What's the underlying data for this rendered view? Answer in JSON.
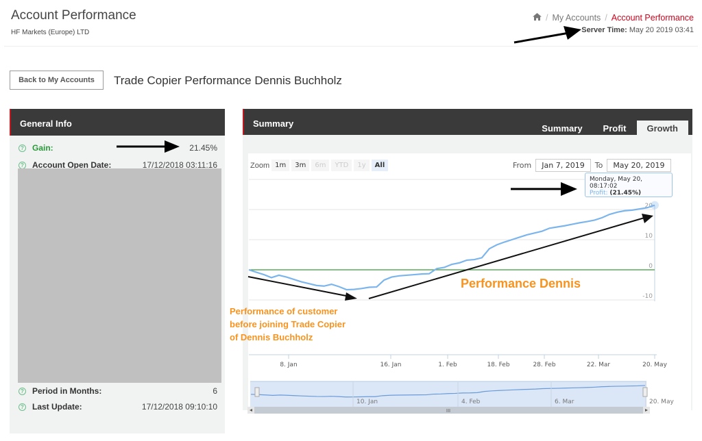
{
  "header": {
    "title": "Account Performance",
    "company": "HF Markets (Europe) LTD",
    "breadcrumb": {
      "home_icon": "home-icon",
      "sep": "/",
      "items": [
        "My Accounts",
        "Account Performance"
      ]
    },
    "server_time_label": "Server Time:",
    "server_time_value": "May 20 2019 03:41"
  },
  "toolbar": {
    "back_label": "Back to My Accounts",
    "page_heading": "Trade Copier Performance Dennis Buchholz"
  },
  "general_info": {
    "title": "General Info",
    "rows_top": [
      {
        "label": "Gain:",
        "value": "21.45%"
      },
      {
        "label": "Account Open Date:",
        "value": "17/12/2018 03:11:16"
      }
    ],
    "rows_bottom": [
      {
        "label": "Period in Months:",
        "value": "6"
      },
      {
        "label": "Last Update:",
        "value": "17/12/2018 09:10:10"
      }
    ],
    "help_icon": "?"
  },
  "summary": {
    "title": "Summary",
    "tabs": [
      "Summary",
      "Profit",
      "Growth"
    ],
    "active_tab": "Growth",
    "zoom_label": "Zoom",
    "zoom_buttons": [
      "1m",
      "3m",
      "6m",
      "YTD",
      "1y",
      "All"
    ],
    "from_label": "From",
    "from_value": "Jan 7, 2019",
    "to_label": "To",
    "to_value": "May 20, 2019",
    "tooltip": {
      "date": "Monday, May 20, 08:17:02",
      "series": "Profit",
      "value": "(21.45%)"
    }
  },
  "annotations": {
    "main": "Performance Dennis",
    "before": [
      "Performance of customer",
      "before joining Trade Copier",
      "of Dennis Buchholz"
    ]
  },
  "colors": {
    "accent_red": "#c4161c",
    "line_blue": "#7cb5ec",
    "zero_line": "#3a9a3a",
    "annotation_orange": "#f7931e"
  },
  "chart_data": {
    "type": "line",
    "title": "",
    "series": [
      {
        "name": "Profit",
        "values": [
          0,
          -0.8,
          -1.6,
          -2.6,
          -1.8,
          -2.4,
          -3.2,
          -4,
          -4.6,
          -5.2,
          -5.4,
          -4.8,
          -5.6,
          -6.6,
          -6.5,
          -6.2,
          -5.8,
          -5.7,
          -3.4,
          -2.4,
          -2,
          -1.8,
          -1.6,
          -1.4,
          -1.3,
          0.4,
          0.8,
          1.8,
          2.3,
          3.2,
          3.4,
          4,
          7,
          8.3,
          9.2,
          10,
          10.8,
          11.6,
          12.2,
          12.8,
          13.8,
          14.2,
          14.6,
          15.1,
          15.6,
          16,
          16.5,
          17.3,
          18.4,
          19.1,
          19.6,
          19.8,
          20.2,
          20.6,
          21.45
        ]
      }
    ],
    "x_tick_labels": [
      "8. Jan",
      "16. Jan",
      "1. Feb",
      "18. Feb",
      "28. Feb",
      "22. Mar",
      "20. May"
    ],
    "y_tick_labels": [
      "-10",
      "0",
      "10",
      "20"
    ],
    "ylim": [
      -10,
      22
    ],
    "navigator_tick_labels": [
      "10. Jan",
      "4. Feb",
      "6. Mar",
      "20. May"
    ],
    "grid": true
  }
}
